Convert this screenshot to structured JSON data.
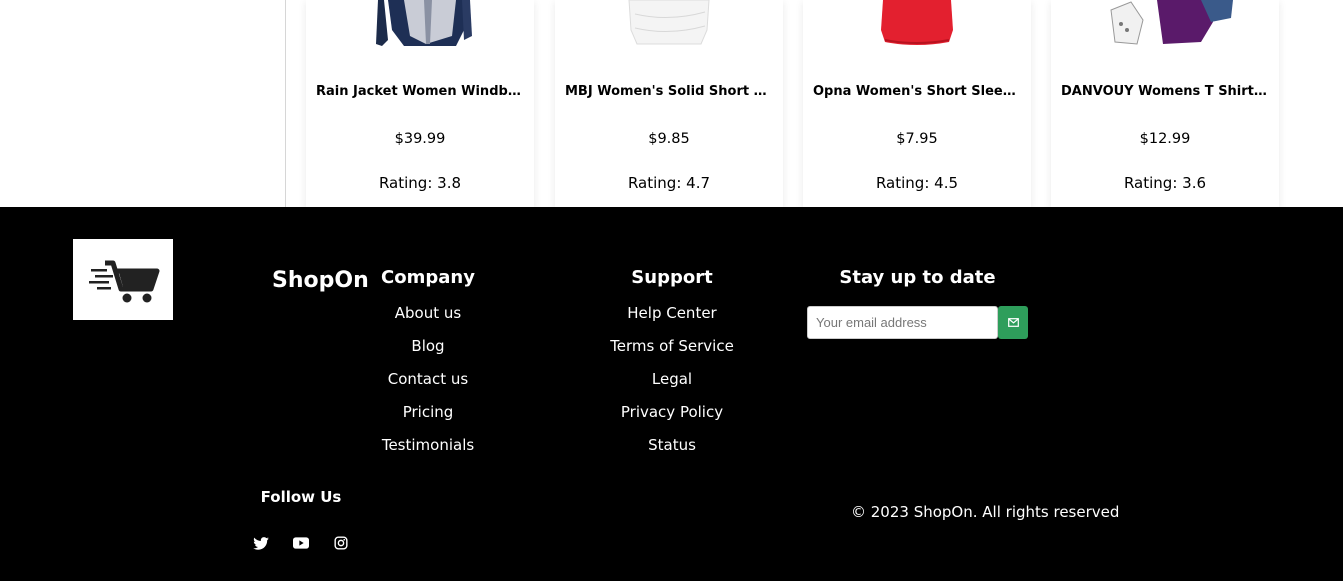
{
  "products": [
    {
      "title": "Rain Jacket Women Windbreaker Striped Climbing Raincoats",
      "price": "$39.99",
      "rating": "Rating: 3.8",
      "image": "rain-jacket-product-image"
    },
    {
      "title": "MBJ Women's Solid Short Sleeve Boat Neck V",
      "price": "$9.85",
      "rating": "Rating: 4.7",
      "image": "white-tshirt-product-image"
    },
    {
      "title": "Opna Women's Short Sleeve Moisture",
      "price": "$7.95",
      "rating": "Rating: 4.5",
      "image": "red-tshirt-product-image"
    },
    {
      "title": "DANVOUY Womens T Shirt Casual Cotton Short",
      "price": "$12.99",
      "rating": "Rating: 3.6",
      "image": "tshirt-shoes-product-image"
    }
  ],
  "footer": {
    "brand": "ShopOn",
    "logo_icon": "shopping-cart-logo-icon",
    "company": {
      "heading": "Company",
      "links": [
        "About us",
        "Blog",
        "Contact us",
        "Pricing",
        "Testimonials"
      ]
    },
    "support": {
      "heading": "Support",
      "links": [
        "Help Center",
        "Terms of Service",
        "Legal",
        "Privacy Policy",
        "Status"
      ]
    },
    "newsletter": {
      "heading": "Stay up to date",
      "placeholder": "Your email address",
      "button_icon": "send-mail-icon"
    },
    "follow_label": "Follow Us",
    "social": [
      "twitter-icon",
      "youtube-icon",
      "instagram-icon"
    ],
    "copyright": "© 2023 ShopOn. All rights reserved"
  },
  "colors": {
    "footer_bg": "#000000",
    "accent": "#2e9e5b"
  }
}
